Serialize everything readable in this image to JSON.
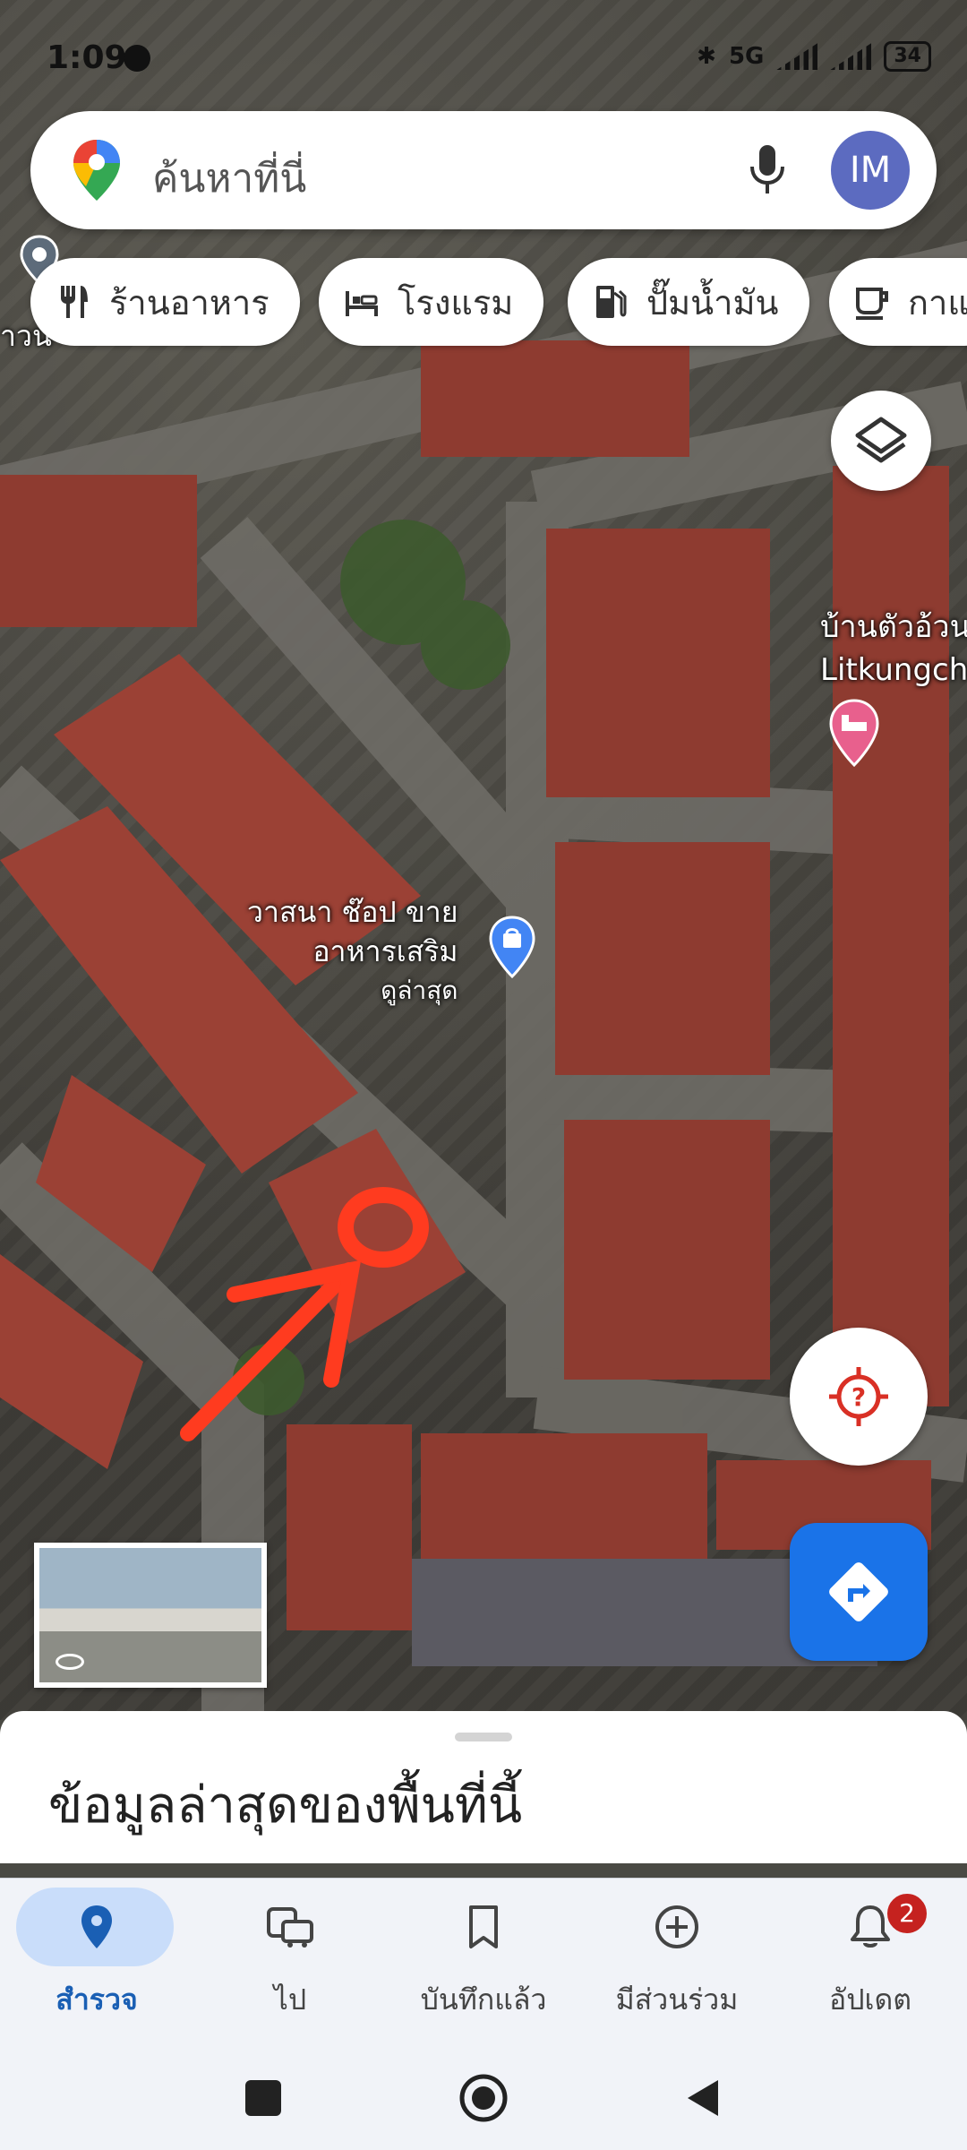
{
  "status_bar": {
    "time": "1:09",
    "battery": "34",
    "network_label": "5G"
  },
  "search": {
    "placeholder": "ค้นหาที่นี่",
    "avatar_initials": "IM"
  },
  "chips": [
    {
      "label": "ร้านอาหาร",
      "icon": "restaurant-icon"
    },
    {
      "label": "โรงแรม",
      "icon": "hotel-icon"
    },
    {
      "label": "ปั๊มน้ำมัน",
      "icon": "gas-station-icon"
    },
    {
      "label": "กาแ",
      "icon": "coffee-icon"
    }
  ],
  "map": {
    "poi_shop": {
      "line1": "วาสนา ช๊อป ขาย",
      "line2": "อาหารเสริม",
      "line3": "ดูล่าสุด"
    },
    "poi_hotel": {
      "line1": "บ้านตัวอ้วน",
      "line2": "Litkungch"
    },
    "edge_label": "าวน",
    "annotation_color": "#ff3b1f"
  },
  "sheet": {
    "title": "ข้อมูลล่าสุดของพื้นที่นี้"
  },
  "bottom_nav": [
    {
      "label": "สำรวจ",
      "icon": "explore-pin-icon",
      "active": true
    },
    {
      "label": "ไป",
      "icon": "commute-icon",
      "active": false
    },
    {
      "label": "บันทึกแล้ว",
      "icon": "bookmark-icon",
      "active": false
    },
    {
      "label": "มีส่วนร่วม",
      "icon": "add-circle-icon",
      "active": false
    },
    {
      "label": "อัปเดต",
      "icon": "bell-icon",
      "active": false,
      "badge": "2"
    }
  ],
  "colors": {
    "accent_blue": "#1a73e8",
    "active_nav": "#1a5fb4",
    "badge_red": "#c5221f",
    "location_red": "#d93025"
  }
}
